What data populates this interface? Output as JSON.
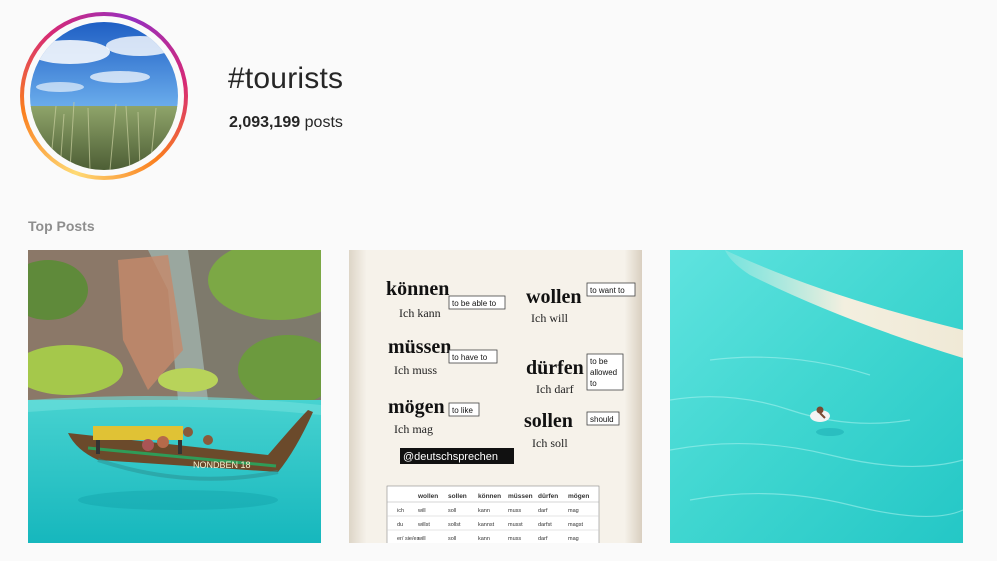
{
  "hashtag": {
    "title": "#tourists",
    "post_count": "2,093,199",
    "post_count_suffix": "posts"
  },
  "section": {
    "top_posts_label": "Top Posts"
  },
  "posts": [
    {
      "name": "post-longtail-boat-lagoon",
      "boat_text": "NONDBEN 18"
    },
    {
      "name": "post-german-modal-verbs",
      "verbs": [
        {
          "verb": "können",
          "example": "Ich kann",
          "meaning": "to be able to"
        },
        {
          "verb": "wollen",
          "example": "Ich will",
          "meaning": "to want to"
        },
        {
          "verb": "müssen",
          "example": "Ich muss",
          "meaning": "to have to"
        },
        {
          "verb": "dürfen",
          "example": "Ich darf",
          "meaning_lines": [
            "to be",
            "allowed",
            "to"
          ]
        },
        {
          "verb": "mögen",
          "example": "Ich mag",
          "meaning": "to like"
        },
        {
          "verb": "sollen",
          "example": "Ich soll",
          "meaning": "should"
        }
      ],
      "handle": "@deutschsprechen",
      "table": {
        "headers": [
          "",
          "wollen",
          "sollen",
          "können",
          "müssen",
          "dürfen",
          "mögen"
        ],
        "rows": [
          [
            "ich",
            "will",
            "soll",
            "kann",
            "muss",
            "darf",
            "mag"
          ],
          [
            "du",
            "willst",
            "sollst",
            "kannst",
            "musst",
            "darfst",
            "magst"
          ],
          [
            "er/ sie/es",
            "will",
            "soll",
            "kann",
            "muss",
            "darf",
            "mag"
          ]
        ]
      }
    },
    {
      "name": "post-turquoise-water-swimmer"
    }
  ],
  "colors": {
    "background": "#fafafa",
    "text": "#262626",
    "muted": "#8e8e8e",
    "water": "#3fd6d0"
  }
}
